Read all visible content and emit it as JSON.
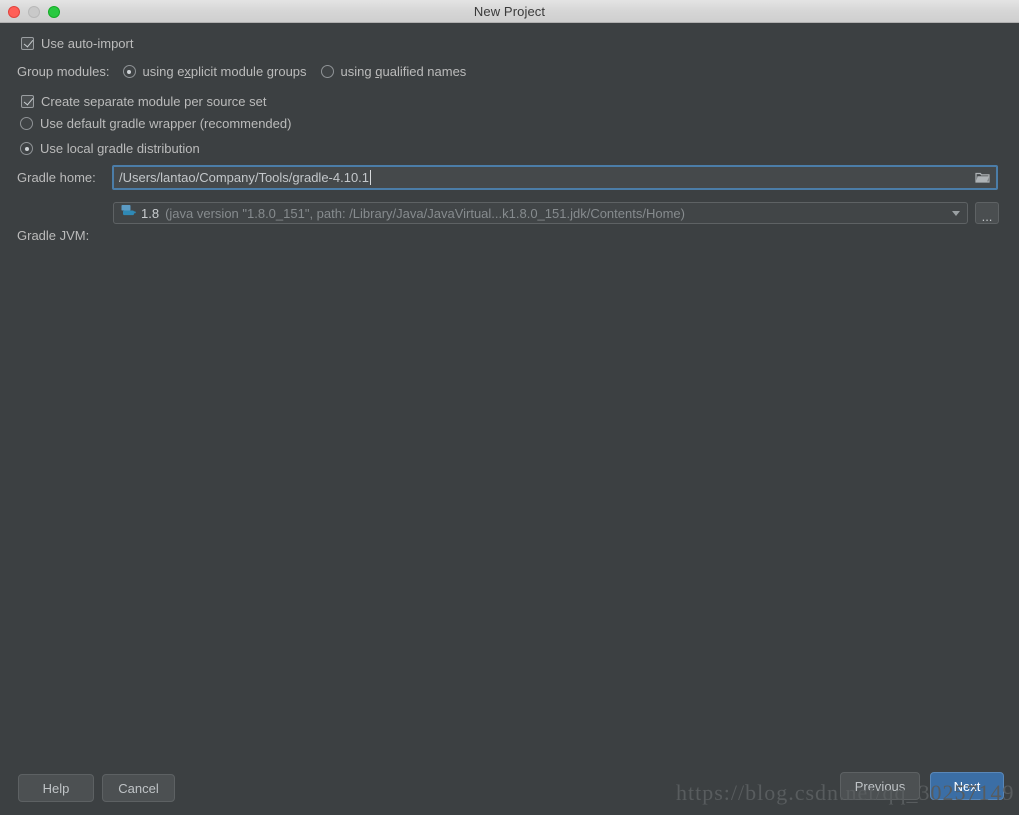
{
  "window": {
    "title": "New Project",
    "traffic_lights": [
      "close-button",
      "minimize-button",
      "maximize-button"
    ]
  },
  "options": {
    "auto_import": {
      "label": "Use auto-import",
      "checked": true
    },
    "group_modules": {
      "label": "Group modules:",
      "choices": [
        {
          "label_before": "using e",
          "mnemonic": "x",
          "label_after": "plicit module groups",
          "selected": true
        },
        {
          "label_before": "using ",
          "mnemonic": "q",
          "label_after": "ualified names",
          "selected": false
        }
      ]
    },
    "separate_module": {
      "label": "Create separate module per source set",
      "checked": true
    },
    "distribution": {
      "choices": [
        {
          "label": "Use default gradle wrapper (recommended)",
          "selected": false
        },
        {
          "label": "Use local gradle distribution",
          "selected": true
        }
      ]
    }
  },
  "gradle_home": {
    "label": "Gradle home:",
    "value": "/Users/lantao/Company/Tools/gradle-4.10.1",
    "placeholder": "",
    "browse_icon": "folder-icon",
    "focused": true
  },
  "gradle_jvm": {
    "label": "Gradle JVM:",
    "icon": "jdk-icon",
    "version": "1.8",
    "description": "(java version \"1.8.0_151\", path: /Library/Java/JavaVirtual...k1.8.0_151.jdk/Contents/Home)",
    "dropdown_icon": "chevron-down-icon",
    "more_button": "..."
  },
  "footer": {
    "help": "Help",
    "cancel": "Cancel",
    "previous": "Previous",
    "next": "Next"
  },
  "watermark": "https://blog.csdn.net/qq_30257149",
  "colors": {
    "background": "#3c4042",
    "accent": "#3b6ea5",
    "focus_border": "#4b7da8",
    "text": "#bbbbbb",
    "muted_text": "#868b8e"
  }
}
